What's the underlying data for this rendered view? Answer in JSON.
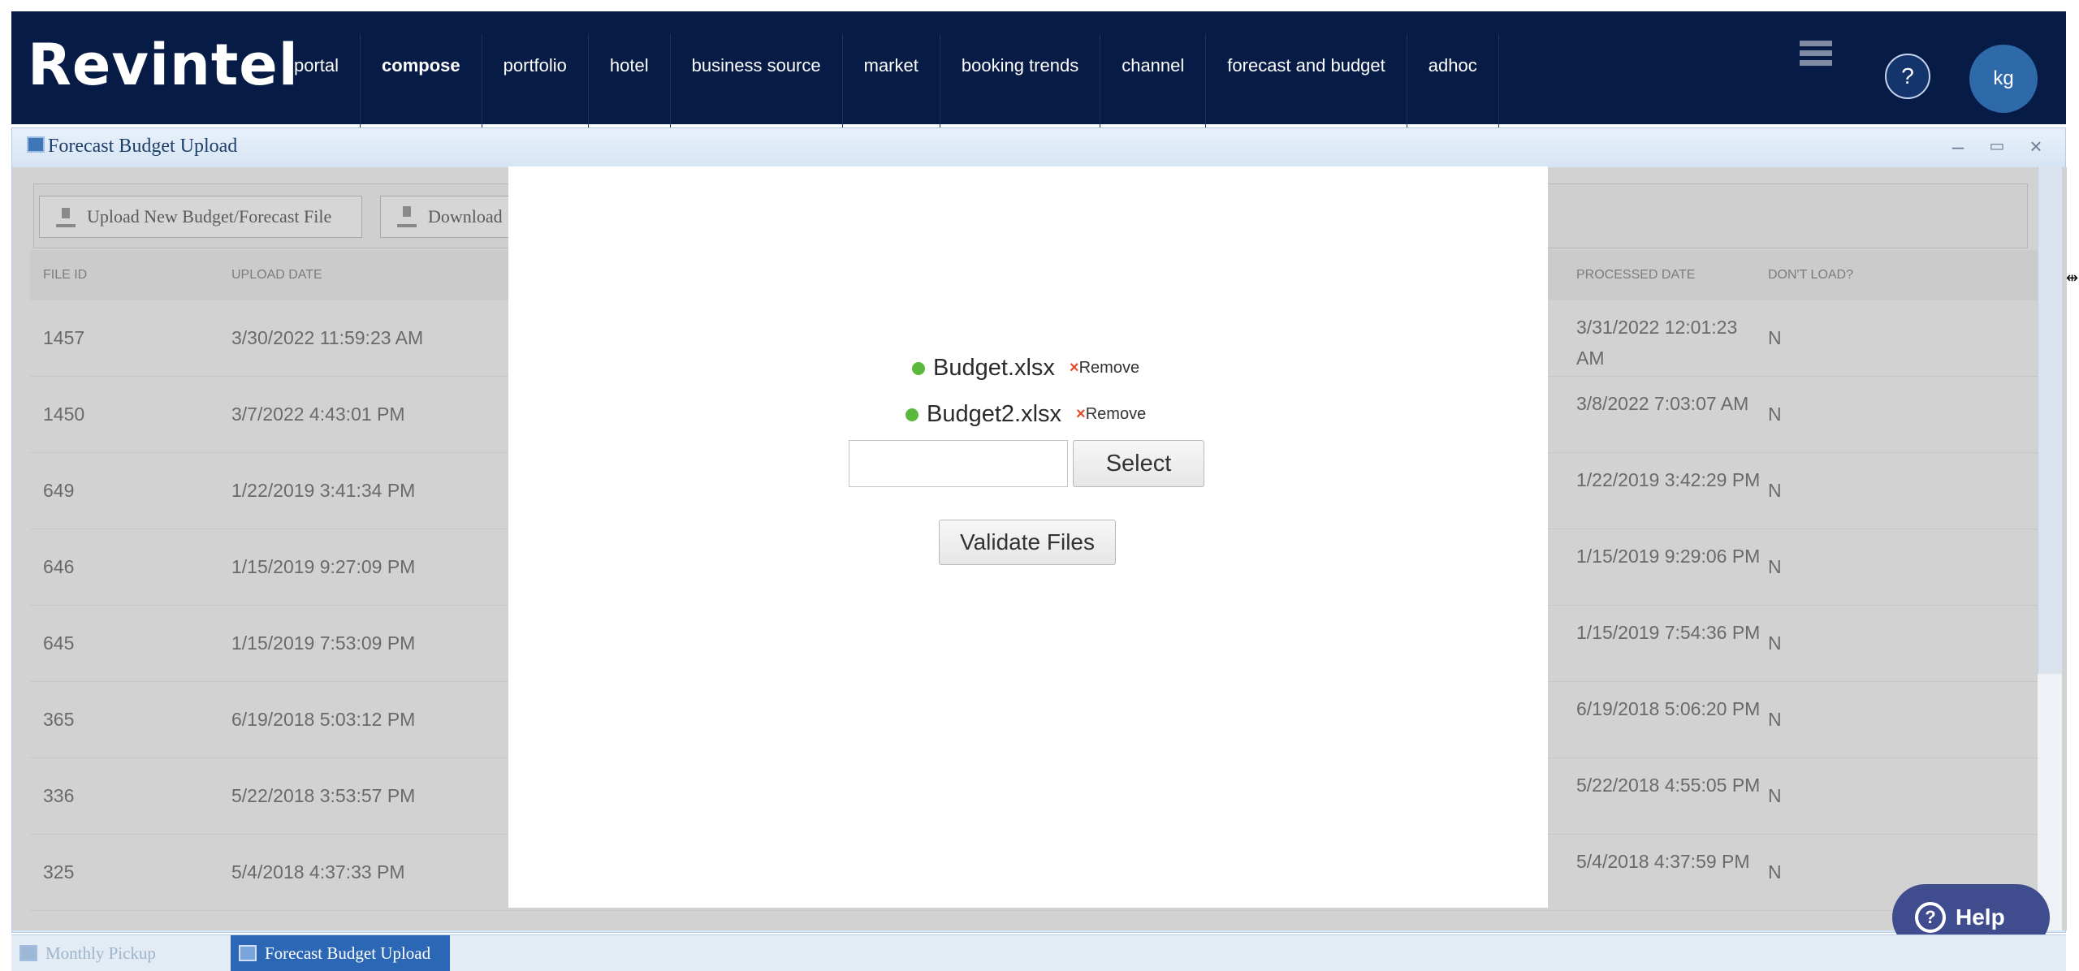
{
  "brand": {
    "logo": "Revintel"
  },
  "nav": {
    "items": [
      {
        "label": "portal",
        "active": false
      },
      {
        "label": "compose",
        "active": true
      },
      {
        "label": "portfolio",
        "active": false
      },
      {
        "label": "hotel",
        "active": false
      },
      {
        "label": "business source",
        "active": false
      },
      {
        "label": "market",
        "active": false
      },
      {
        "label": "booking trends",
        "active": false
      },
      {
        "label": "channel",
        "active": false
      },
      {
        "label": "forecast and budget",
        "active": false
      },
      {
        "label": "adhoc",
        "active": false
      }
    ],
    "menu_icon": "hamburger-menu-icon",
    "help_icon_text": "?",
    "avatar_initials": "kg"
  },
  "window": {
    "title": "Forecast Budget Upload",
    "controls": [
      "minimize-icon",
      "maximize-icon",
      "close-icon"
    ],
    "toolbar": {
      "upload_label": "Upload New Budget/Forecast File",
      "download_label": "Download"
    },
    "grid": {
      "columns": {
        "file_id": "FILE ID",
        "upload_date": "UPLOAD DATE",
        "processed_date": "PROCESSED DATE",
        "dont_load": "DON'T LOAD?"
      },
      "rows": [
        {
          "file_id": "1457",
          "upload_date": "3/30/2022 11:59:23 AM",
          "processed_date": "3/31/2022 12:01:23 AM",
          "dont_load": "N"
        },
        {
          "file_id": "1450",
          "upload_date": "3/7/2022 4:43:01 PM",
          "processed_date": "3/8/2022 7:03:07 AM",
          "dont_load": "N"
        },
        {
          "file_id": "649",
          "upload_date": "1/22/2019 3:41:34 PM",
          "processed_date": "1/22/2019 3:42:29 PM",
          "dont_load": "N"
        },
        {
          "file_id": "646",
          "upload_date": "1/15/2019 9:27:09 PM",
          "processed_date": "1/15/2019 9:29:06 PM",
          "dont_load": "N"
        },
        {
          "file_id": "645",
          "upload_date": "1/15/2019 7:53:09 PM",
          "processed_date": "1/15/2019 7:54:36 PM",
          "dont_load": "N"
        },
        {
          "file_id": "365",
          "upload_date": "6/19/2018 5:03:12 PM",
          "processed_date": "6/19/2018 5:06:20 PM",
          "dont_load": "N"
        },
        {
          "file_id": "336",
          "upload_date": "5/22/2018 3:53:57 PM",
          "processed_date": "5/22/2018 4:55:05 PM",
          "dont_load": "N"
        },
        {
          "file_id": "325",
          "upload_date": "5/4/2018 4:37:33 PM",
          "processed_date": "5/4/2018 4:37:59 PM",
          "dont_load": "N"
        }
      ]
    }
  },
  "upload_modal": {
    "files": [
      {
        "name": "Budget.xlsx",
        "remove_label": "Remove"
      },
      {
        "name": "Budget2.xlsx",
        "remove_label": "Remove"
      }
    ],
    "file_input_value": "",
    "select_label": "Select",
    "validate_label": "Validate Files"
  },
  "help_button": {
    "label": "Help"
  },
  "taskbar": {
    "tasks": [
      {
        "label": "Monthly Pickup",
        "active": false
      },
      {
        "label": "Forecast Budget Upload",
        "active": true
      }
    ]
  },
  "colors": {
    "nav_bg": "#061b45",
    "window_title_bg": "#d6e4f3",
    "file_status_dot": "#5ab93c",
    "remove_x": "#e34b2c",
    "help_button_bg": "#3f4d8f",
    "taskbar_active": "#2b67b5"
  }
}
